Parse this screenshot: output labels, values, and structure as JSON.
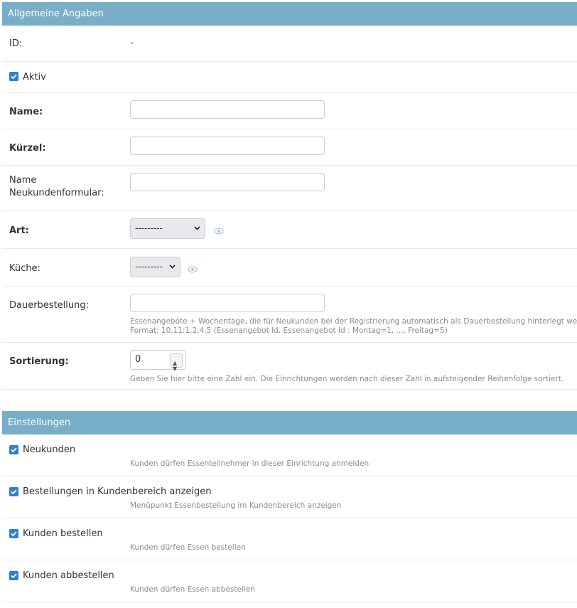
{
  "general": {
    "header": "Allgemeine Angaben",
    "id_label": "ID:",
    "id_value": "-",
    "active_label": "Aktiv",
    "name_label": "Name:",
    "name_value": "",
    "short_label": "Kürzel:",
    "short_value": "",
    "signup_name_label_1": "Name",
    "signup_name_label_2": "Neukundenformular:",
    "signup_name_value": "",
    "type_label": "Art:",
    "type_selected": "---------",
    "kitchen_label": "Küche:",
    "kitchen_selected": "---------",
    "standing_label": "Dauerbestellung:",
    "standing_value": "",
    "standing_help_1": "Essenangebote + Wochentage, die für Neukunden bei der Registrierung automatisch als Dauerbestellung hinterlegt werden.",
    "standing_help_2": "Format: 10,11:1,2,4,5 (Essenangebot Id, Essenangebot Id : Montag=1, ..., Freitag=5)",
    "sort_label": "Sortierung:",
    "sort_value": "0",
    "sort_help": "Geben Sie hier bitte eine Zahl ein. Die Einrichtungen werden nach dieser Zahl in aufsteigender Reihenfolge sortiert."
  },
  "settings": {
    "header": "Einstellungen",
    "items": [
      {
        "label": "Neukunden",
        "help": "Kunden dürfen Essenteilnehmer in dieser Einrichtung anmelden",
        "checked": true
      },
      {
        "label": "Bestellungen in Kundenbereich anzeigen",
        "help": "Menüpunkt Essenbestellung im Kundenbereich anzeigen",
        "checked": true
      },
      {
        "label": "Kunden bestellen",
        "help": "Kunden dürfen Essen bestellen",
        "checked": true
      },
      {
        "label": "Kunden abbestellen",
        "help": "Kunden dürfen Essen abbestellen",
        "checked": true
      }
    ]
  },
  "colors": {
    "header_bg": "#79aec8",
    "checkbox": "#2f7fd6"
  },
  "icons": {
    "check": "check-icon",
    "eye": "eye-icon",
    "chevron": "chevron-down-icon"
  }
}
